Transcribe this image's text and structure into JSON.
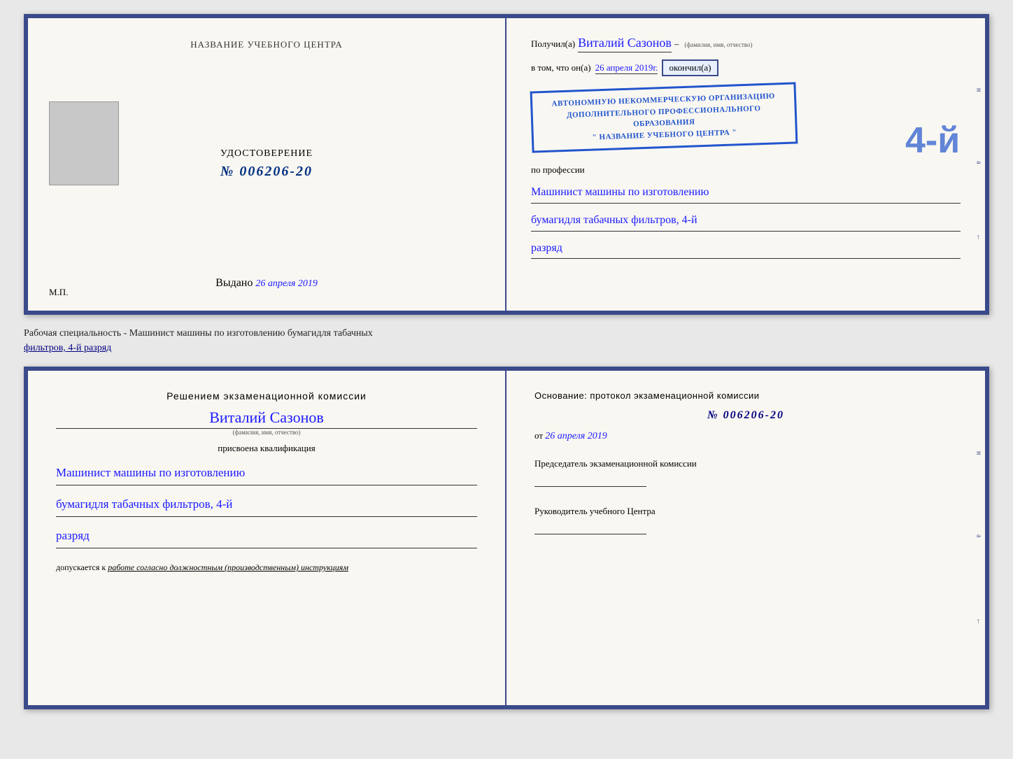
{
  "top_cert": {
    "left": {
      "training_center_title": "НАЗВАНИЕ УЧЕБНОГО ЦЕНТРА",
      "udostoverenie_label": "УДОСТОВЕРЕНИЕ",
      "number": "№ 006206-20",
      "vydano_prefix": "Выдано",
      "vydano_date": "26 апреля 2019",
      "mp_label": "М.П."
    },
    "right": {
      "poluchil_prefix": "Получил(а)",
      "recipient_name": "Виталий Сазонов",
      "fio_label": "(фамилия, имя, отчество)",
      "vtom_prefix": "в том, что он(а)",
      "date_handwritten": "26 апреля 2019г.",
      "okonchil_label": "окончил(а)",
      "big_number": "4-й",
      "stamp_line1": "АВТОНОМНУЮ НЕКОММЕРЧЕСКУЮ ОРГАНИЗАЦИЮ",
      "stamp_line2": "ДОПОЛНИТЕЛЬНОГО ПРОФЕССИОНАЛЬНОГО ОБРАЗОВАНИЯ",
      "stamp_line3": "\" НАЗВАНИЕ УЧЕБНОГО ЦЕНТРА \"",
      "po_professii": "по профессии",
      "profession1": "Машинист машины по изготовлению",
      "profession2": "бумагидля табачных фильтров, 4-й",
      "profession3": "разряд"
    }
  },
  "annotation": {
    "text1": "Рабочая специальность - Машинист машины по изготовлению бумагидля табачных",
    "text2": "фильтров, 4-й разряд"
  },
  "bottom_cert": {
    "left": {
      "resheniem_title": "Решением  экзаменационной  комиссии",
      "name": "Виталий Сазонов",
      "fio_label": "(фамилия, имя, отчество)",
      "prisvoena_label": "присвоена квалификация",
      "profession1": "Машинист машины по изготовлению",
      "profession2": "бумагидля табачных фильтров, 4-й",
      "profession3": "разряд",
      "dopuskaetsya_prefix": "допускается к",
      "dopuskaetsya_value": "работе согласно должностным (производственным) инструкциям"
    },
    "right": {
      "osnovaniye_title": "Основание: протокол экзаменационной  комиссии",
      "number": "№  006206-20",
      "ot_prefix": "от",
      "ot_date": "26 апреля 2019",
      "predsedatel_label": "Председатель экзаменационной комиссии",
      "rukovoditel_label": "Руководитель учебного Центра"
    }
  },
  "edge_marks": {
    "top_right": [
      "и",
      "а",
      "←"
    ],
    "bottom_right": [
      "и",
      "а",
      "←"
    ]
  }
}
